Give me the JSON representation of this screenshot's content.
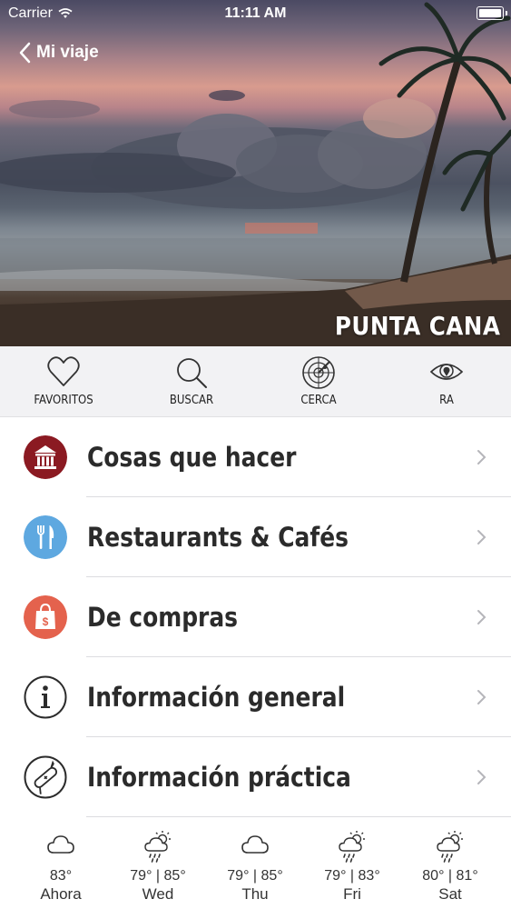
{
  "status_bar": {
    "carrier": "Carrier",
    "time": "11:11 AM"
  },
  "nav": {
    "back_label": "Mi viaje"
  },
  "hero": {
    "title": "PUNTA CANA"
  },
  "toolbar": [
    {
      "label": "FAVORITOS",
      "icon": "heart-icon"
    },
    {
      "label": "BUSCAR",
      "icon": "search-icon"
    },
    {
      "label": "CERCA",
      "icon": "radar-icon"
    },
    {
      "label": "RA",
      "icon": "eye-location-icon"
    }
  ],
  "menu": [
    {
      "label": "Cosas que hacer",
      "icon": "museum-icon",
      "color": "#8b1a22"
    },
    {
      "label": "Restaurants & Cafés",
      "icon": "fork-knife-icon",
      "color": "#5ea8e0"
    },
    {
      "label": "De compras",
      "icon": "shopping-bag-icon",
      "color": "#e4624d"
    },
    {
      "label": "Información general",
      "icon": "info-icon",
      "color": "#ffffff"
    },
    {
      "label": "Información práctica",
      "icon": "swiss-knife-icon",
      "color": "#ffffff"
    }
  ],
  "weather": [
    {
      "temp": "83°",
      "day": "Ahora",
      "icon": "cloud-icon"
    },
    {
      "temp": "79° | 85°",
      "day": "Wed",
      "icon": "sun-rain-icon"
    },
    {
      "temp": "79° | 85°",
      "day": "Thu",
      "icon": "cloud-icon"
    },
    {
      "temp": "79° | 83°",
      "day": "Fri",
      "icon": "sun-rain-icon"
    },
    {
      "temp": "80° | 81°",
      "day": "Sat",
      "icon": "sun-rain-icon"
    }
  ]
}
